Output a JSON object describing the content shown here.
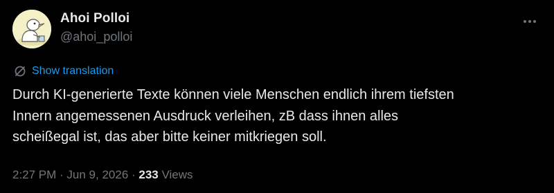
{
  "author": {
    "display_name": "Ahoi Polloi",
    "handle": "@ahoi_polloi",
    "avatar_icon": "cartoon-avatar-icon"
  },
  "more_icon": "more-horizontal-icon",
  "translation": {
    "icon": "translate-icon",
    "label": "Show translation"
  },
  "tweet": {
    "lines": [
      "Durch KI-generierte Texte können viele Menschen endlich ihrem tiefsten",
      "Innern angemessenen Ausdruck verleihen, zB dass ihnen alles",
      "scheißegal ist, das aber bitte keiner mitkriegen soll."
    ]
  },
  "meta": {
    "time": "2:27 PM",
    "separator1": " · ",
    "date": "Jun 9, 2026",
    "separator2": " · ",
    "views_count": "233",
    "views_label": " Views"
  },
  "colors": {
    "background": "#000000",
    "text": "#e7e9ea",
    "secondary": "#71767b",
    "link": "#1d9bf0"
  }
}
